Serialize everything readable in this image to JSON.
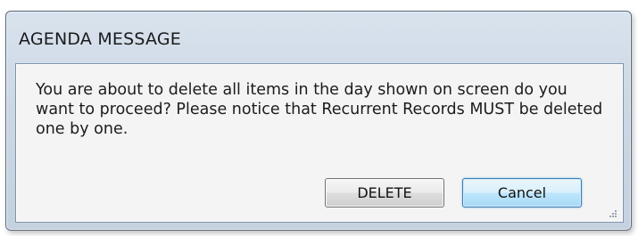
{
  "dialog": {
    "title": "AGENDA MESSAGE",
    "message": "You are about to delete all items in the day shown on screen do you want to proceed? Please notice that Recurrent Records MUST be deleted one by one."
  },
  "buttons": {
    "delete_label": "DELETE",
    "cancel_label": "Cancel"
  },
  "colors": {
    "frame": "#cbd7e4",
    "content_bg": "#f4f4f4",
    "default_button_border": "#3c7fb1"
  },
  "icons": {
    "resize_grip": "resize-grip-icon"
  }
}
